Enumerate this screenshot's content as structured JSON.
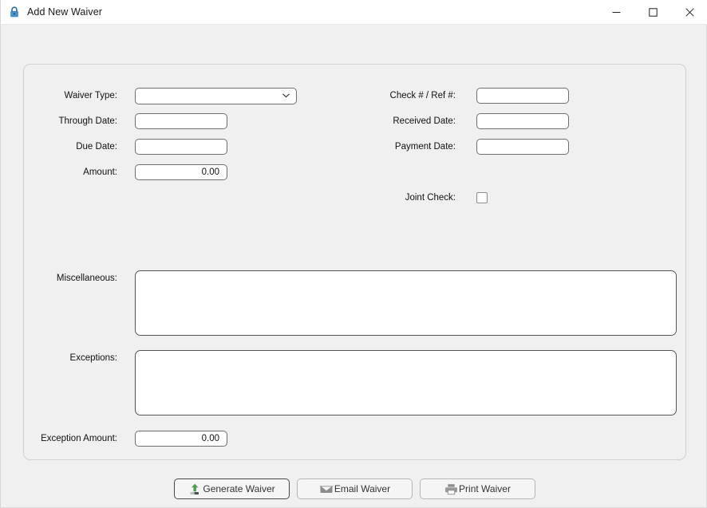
{
  "window": {
    "title": "Add New Waiver",
    "icon": "lock-icon",
    "controls": {
      "minimize": "Minimize",
      "maximize": "Maximize",
      "close": "Close"
    }
  },
  "form": {
    "left_column": [
      {
        "label": "Waiver Type:",
        "value": "",
        "placeholder": "",
        "type": "combobox"
      },
      {
        "label": "Through Date:",
        "value": "",
        "placeholder": "",
        "type": "text"
      },
      {
        "label": "Due Date:",
        "value": "",
        "placeholder": "",
        "type": "text"
      },
      {
        "label": "Amount:",
        "value": "0.00",
        "placeholder": "",
        "type": "number"
      }
    ],
    "right_column": [
      {
        "label": "Check # / Ref #:",
        "value": "",
        "placeholder": "",
        "type": "text"
      },
      {
        "label": "Received Date:",
        "value": "",
        "placeholder": "",
        "type": "text"
      },
      {
        "label": "Payment Date:",
        "value": "",
        "placeholder": "",
        "type": "text"
      }
    ],
    "joint_check": {
      "label": "Joint Check:",
      "checked": false
    },
    "miscellaneous": {
      "label": "Miscellaneous:",
      "value": "",
      "placeholder": ""
    },
    "exceptions": {
      "label": "Exceptions:",
      "value": "",
      "placeholder": ""
    },
    "exception_amount": {
      "label": "Exception Amount:",
      "value": "0.00",
      "placeholder": ""
    }
  },
  "buttons": [
    {
      "label": "Generate Waiver",
      "icon": "upload-arrow-icon",
      "focused": true
    },
    {
      "label": "Email Waiver",
      "icon": "envelope-icon",
      "focused": false
    },
    {
      "label": "Print Waiver",
      "icon": "printer-icon",
      "focused": false
    }
  ],
  "colors": {
    "accent_green": "#4f9c4f",
    "icon_gray": "#8c8c8c",
    "window_bg": "#f0f0f0",
    "titlebar_bg": "#ffffff",
    "lock_blue": "#2b6ca3"
  }
}
